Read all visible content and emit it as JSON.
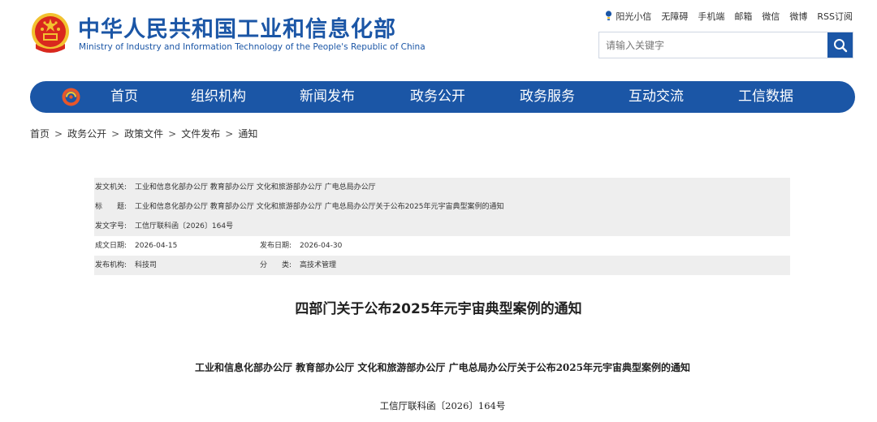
{
  "header": {
    "title": "中华人民共和国工业和信息化部",
    "subtitle": "Ministry of Industry and Information Technology of the People's Republic of China",
    "logo_icon": "national-emblem-icon",
    "top_links": [
      "阳光小信",
      "无障碍",
      "手机端",
      "邮箱",
      "微信",
      "微博",
      "RSS订阅"
    ],
    "search": {
      "placeholder": "请输入关键字",
      "value": "",
      "icon": "search-icon"
    }
  },
  "nav": {
    "items": [
      "首页",
      "组织机构",
      "新闻发布",
      "政务公开",
      "政务服务",
      "互动交流",
      "工信数据"
    ]
  },
  "breadcrumb": {
    "items": [
      "首页",
      "政务公开",
      "政策文件",
      "文件发布",
      "通知"
    ],
    "separator": ">"
  },
  "meta": {
    "issuer_label": "发文机关:",
    "issuer": "工业和信息化部办公厅 教育部办公厅 文化和旅游部办公厅 广电总局办公厅",
    "title_label": "标　　题:",
    "title": "工业和信息化部办公厅 教育部办公厅 文化和旅游部办公厅 广电总局办公厅关于公布2025年元宇宙典型案例的通知",
    "docno_label": "发文字号:",
    "docno": "工信厅联科函〔2026〕164号",
    "created_label": "成文日期:",
    "created": "2026-04-15",
    "published_label": "发布日期:",
    "published": "2026-04-30",
    "org_label": "发布机构:",
    "org": "科技司",
    "category_label": "分　　类:",
    "category": "高技术管理"
  },
  "article": {
    "title": "四部门关于公布2025年元宇宙典型案例的通知",
    "subtitle": "工业和信息化部办公厅  教育部办公厅  文化和旅游部办公厅  广电总局办公厅关于公布2025年元宇宙典型案例的通知",
    "docno": "工信厅联科函〔2026〕164号"
  },
  "colors": {
    "brand_blue": "#1b56a6",
    "table_shade": "#eeeeee",
    "emblem_red": "#d9281e",
    "emblem_gold": "#f2c230"
  }
}
